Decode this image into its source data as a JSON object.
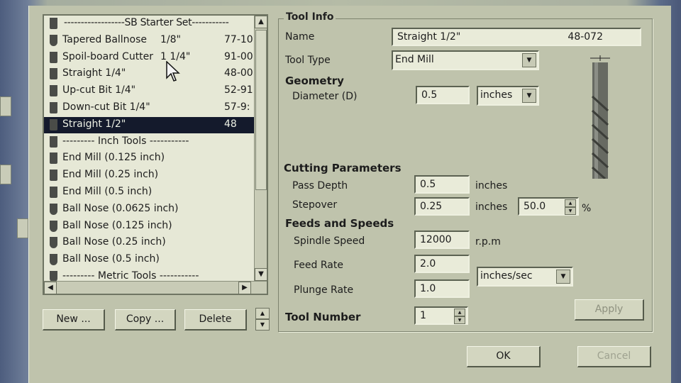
{
  "tool_list": {
    "rows": [
      {
        "name": "------------------SB Starter Set-----------",
        "size": "",
        "code": "",
        "kind": "header",
        "selected": false
      },
      {
        "name": "Tapered Ballnose",
        "size": "1/8\"",
        "code": "77-10",
        "kind": "ball",
        "selected": false
      },
      {
        "name": "Spoil-board Cutter",
        "size": "1 1/4\"",
        "code": "91-00",
        "kind": "flat",
        "selected": false
      },
      {
        "name": "Straight 1/4\"",
        "size": "",
        "code": "48-00!",
        "kind": "flat",
        "selected": false
      },
      {
        "name": "Up-cut Bit 1/4\"",
        "size": "",
        "code": "52-91",
        "kind": "flat",
        "selected": false
      },
      {
        "name": "Down-cut Bit 1/4\"",
        "size": "",
        "code": "57-9:",
        "kind": "flat",
        "selected": false
      },
      {
        "name": "Straight 1/2\"",
        "size": "",
        "code": "48",
        "kind": "flat",
        "selected": true
      },
      {
        "name": "--------- Inch Tools -----------",
        "size": "",
        "code": "",
        "kind": "flat",
        "selected": false
      },
      {
        "name": "End Mill (0.125 inch)",
        "size": "",
        "code": "",
        "kind": "flat",
        "selected": false
      },
      {
        "name": "End Mill (0.25 inch)",
        "size": "",
        "code": "",
        "kind": "flat",
        "selected": false
      },
      {
        "name": "End Mill (0.5 inch)",
        "size": "",
        "code": "",
        "kind": "flat",
        "selected": false
      },
      {
        "name": "Ball Nose (0.0625 inch)",
        "size": "",
        "code": "",
        "kind": "ball",
        "selected": false
      },
      {
        "name": "Ball Nose (0.125 inch)",
        "size": "",
        "code": "",
        "kind": "ball",
        "selected": false
      },
      {
        "name": "Ball Nose (0.25 inch)",
        "size": "",
        "code": "",
        "kind": "ball",
        "selected": false
      },
      {
        "name": "Ball Nose (0.5 inch)",
        "size": "",
        "code": "",
        "kind": "ball",
        "selected": false
      },
      {
        "name": "--------- Metric Tools -----------",
        "size": "",
        "code": "",
        "kind": "ball",
        "selected": false
      }
    ]
  },
  "buttons": {
    "new": "New ...",
    "copy": "Copy ...",
    "delete": "Delete",
    "apply": "Apply",
    "ok": "OK",
    "cancel": "Cancel"
  },
  "tool_info": {
    "title": "Tool Info",
    "name_label": "Name",
    "name_value": "Straight 1/2\"",
    "name_code": "48-072",
    "tool_type_label": "Tool Type",
    "tool_type_value": "End Mill",
    "geometry_heading": "Geometry",
    "diameter_label": "Diameter (D)",
    "diameter_value": "0.5",
    "diameter_units": "inches"
  },
  "cutting": {
    "heading": "Cutting Parameters",
    "pass_depth_label": "Pass Depth",
    "pass_depth_value": "0.5",
    "pass_depth_units": "inches",
    "stepover_label": "Stepover",
    "stepover_value": "0.25",
    "stepover_units": "inches",
    "stepover_percent": "50.0",
    "percent_sign": "%"
  },
  "feeds": {
    "heading": "Feeds and Speeds",
    "spindle_label": "Spindle Speed",
    "spindle_value": "12000",
    "spindle_units": "r.p.m",
    "feed_label": "Feed Rate",
    "feed_value": "2.0",
    "plunge_label": "Plunge Rate",
    "plunge_value": "1.0",
    "rate_units": "inches/sec"
  },
  "tool_number": {
    "label": "Tool Number",
    "value": "1"
  },
  "colors": {
    "dialog_bg": "#bfc3ac",
    "selected_row": "#141a2c",
    "field_bg": "#e9ebd9"
  }
}
